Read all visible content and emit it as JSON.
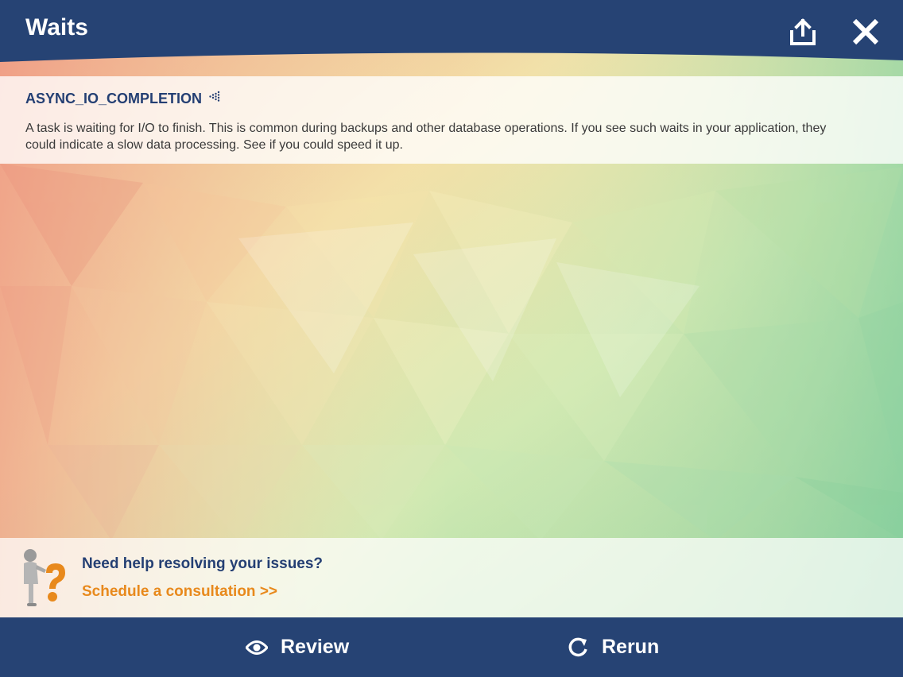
{
  "header": {
    "title": "Waits",
    "share_icon": "share-icon",
    "close_icon": "close-icon",
    "bar_color": "#264374"
  },
  "wait": {
    "name": "ASYNC_IO_COMPLETION",
    "indicator_icon": "dotted-arrow-icon",
    "description": "A task is waiting for I/O to finish. This is common during backups and other database operations. If you see such waits in your application, they could indicate a slow data processing. See if you could speed it up."
  },
  "help": {
    "question": "Need help resolving your issues?",
    "link": "Schedule a consultation >>",
    "figure_icon": "question-mark-figure-icon",
    "link_color": "#e8891c"
  },
  "footer": {
    "review_label": "Review",
    "review_icon": "eye-icon",
    "rerun_label": "Rerun",
    "rerun_icon": "refresh-icon"
  }
}
